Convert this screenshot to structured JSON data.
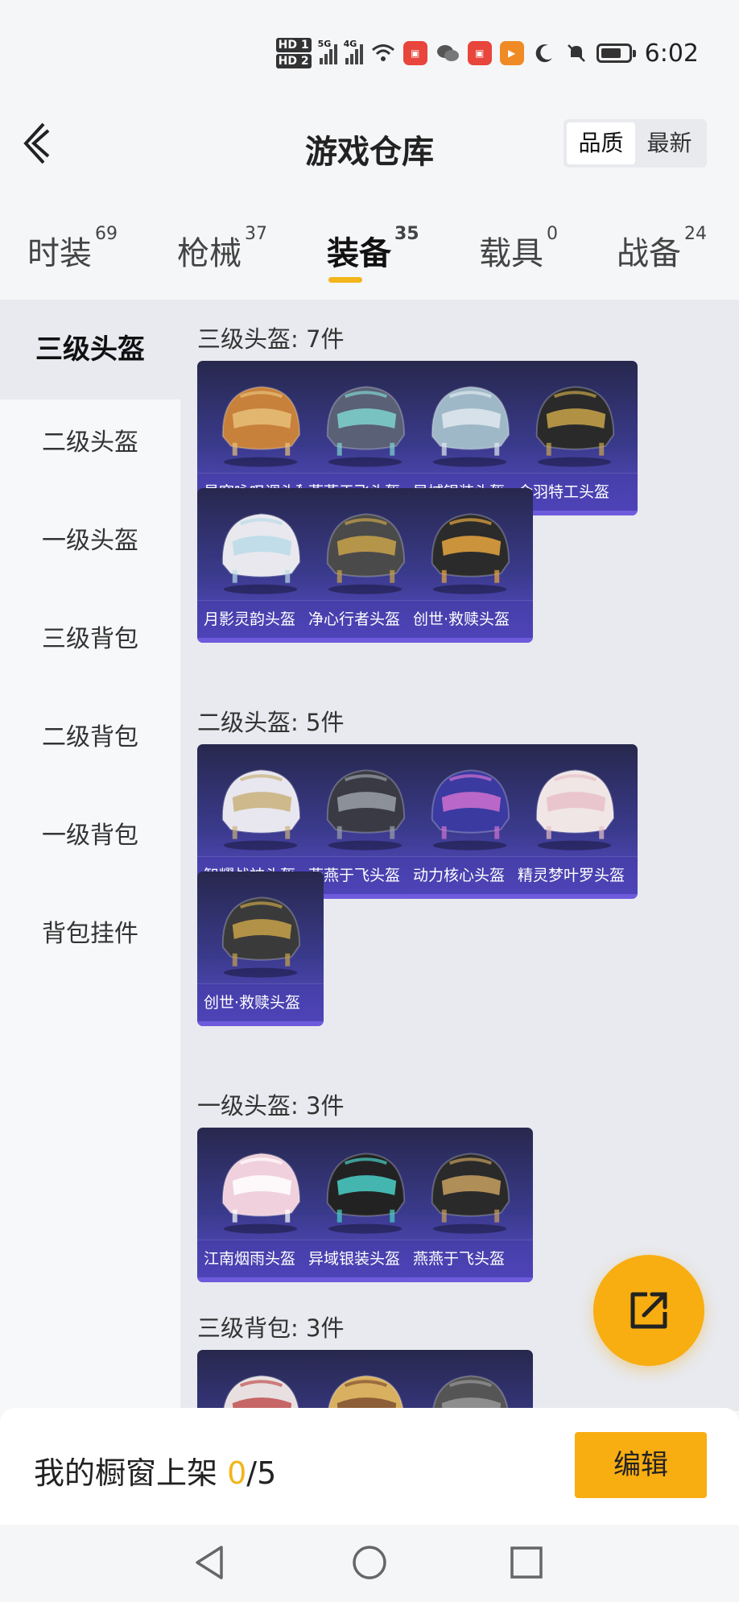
{
  "status_bar": {
    "hd1": "HD 1",
    "hd2": "HD 2",
    "net1": "5G",
    "net2": "4G",
    "time": "6:02"
  },
  "header": {
    "title": "游戏仓库",
    "sort_quality": "品质",
    "sort_newest": "最新"
  },
  "tabs": [
    {
      "label": "时装",
      "count": "69"
    },
    {
      "label": "枪械",
      "count": "37"
    },
    {
      "label": "装备",
      "count": "35"
    },
    {
      "label": "载具",
      "count": "0"
    },
    {
      "label": "战备",
      "count": "24"
    }
  ],
  "sidebar": {
    "items": [
      "三级头盔",
      "二级头盔",
      "一级头盔",
      "三级背包",
      "二级背包",
      "一级背包",
      "背包挂件"
    ]
  },
  "sections": [
    {
      "title": "三级头盔: 7件",
      "items": [
        "星穹咏叹调头盔",
        "燕燕于飞头盔",
        "异域银装头盔",
        "金羽特工头盔",
        "月影灵韵头盔",
        "净心行者头盔",
        "创世·救赎头盔"
      ]
    },
    {
      "title": "二级头盔: 5件",
      "items": [
        "智耀战神头盔",
        "燕燕于飞头盔",
        "动力核心头盔",
        "精灵梦叶罗头盔",
        "创世·救赎头盔"
      ]
    },
    {
      "title": "一级头盔: 3件",
      "items": [
        "江南烟雨头盔",
        "异域银装头盔",
        "燕燕于飞头盔"
      ]
    },
    {
      "title": "三级背包: 3件",
      "items": [
        "",
        "",
        ""
      ]
    }
  ],
  "bottom": {
    "label": "我的橱窗上架 ",
    "count_current": "0",
    "count_total": "/5",
    "edit_label": "编辑"
  },
  "colors": {
    "accent": "#f8ad11",
    "underline": "#f2b51a",
    "card_top": "#27284d",
    "card_bottom": "#5b4fcf"
  }
}
